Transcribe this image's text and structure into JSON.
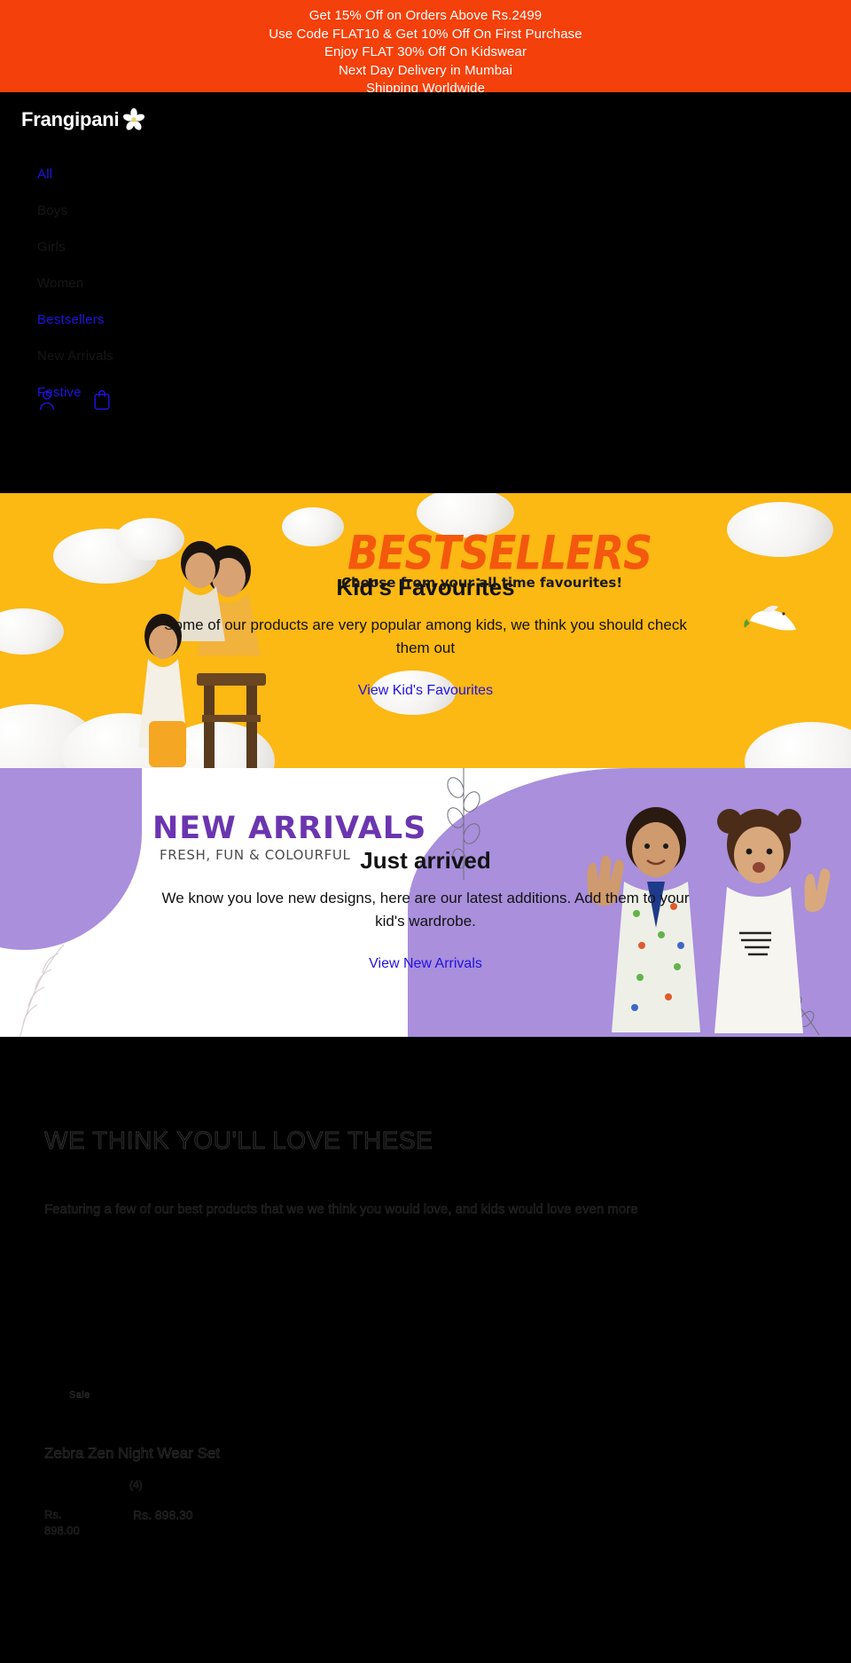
{
  "announcement": {
    "lines": [
      "Get 15% Off on Orders Above Rs.2499",
      "Use Code FLAT10 & Get 10% Off On First Purchase",
      "Enjoy FLAT 30% Off On Kidswear",
      "Next Day Delivery in Mumbai",
      "Shipping Worldwide"
    ],
    "background": "#f4400a",
    "color": "#ffffff"
  },
  "header": {
    "logo_text": "Frangipani",
    "logo_icon": "frangipani-flower-icon",
    "background": "#000000",
    "nav": [
      {
        "label": "All",
        "link_color": "#2112e0"
      },
      {
        "label": "Boys",
        "link_color": "#161616"
      },
      {
        "label": "Girls",
        "link_color": "#161616"
      },
      {
        "label": "Women",
        "link_color": "#161616"
      },
      {
        "label": "Bestsellers",
        "link_color": "#2112e0"
      },
      {
        "label": "New Arrivals",
        "link_color": "#161616"
      },
      {
        "label": "Festive",
        "link_color": "#2112e0"
      }
    ],
    "icons": [
      {
        "name": "account-icon",
        "label": "Account"
      },
      {
        "name": "cart-icon",
        "label": "Cart"
      }
    ]
  },
  "bestsellers": {
    "banner_title": "BESTSELLERS",
    "banner_subtitle": "Choose from your all time favourites!",
    "heading": "Kid's Favourites",
    "body": "Some of our products are very popular among kids, we think you should check them out",
    "cta": "View Kid's Favourites",
    "background": "#fcb813",
    "title_color": "#f4580d",
    "cta_color": "#2112e0"
  },
  "new_arrivals": {
    "banner_title": "NEW ARRIVALS",
    "banner_subtitle": "FRESH, FUN & COLOURFUL",
    "heading": "Just arrived",
    "body": "We know you love new designs, here are our latest additions. Add them to your kid's wardrobe.",
    "cta": "View New Arrivals",
    "background": "#ffffff",
    "accent_color": "#a98fdc",
    "title_color": "#6b35b0",
    "cta_color": "#2112e0"
  },
  "products_section": {
    "heading": "WE THINK YOU'LL LOVE THESE",
    "description": "Featuring a few of our best products that we we think you would love, and kids would love even more",
    "background": "#000000",
    "cards": [
      {
        "badge": "Sale",
        "title": "Zebra Zen Night Wear Set",
        "rating_count": "(4)",
        "price_original": "Rs. 898.00",
        "price_sale": "Rs. 898.30"
      }
    ]
  }
}
